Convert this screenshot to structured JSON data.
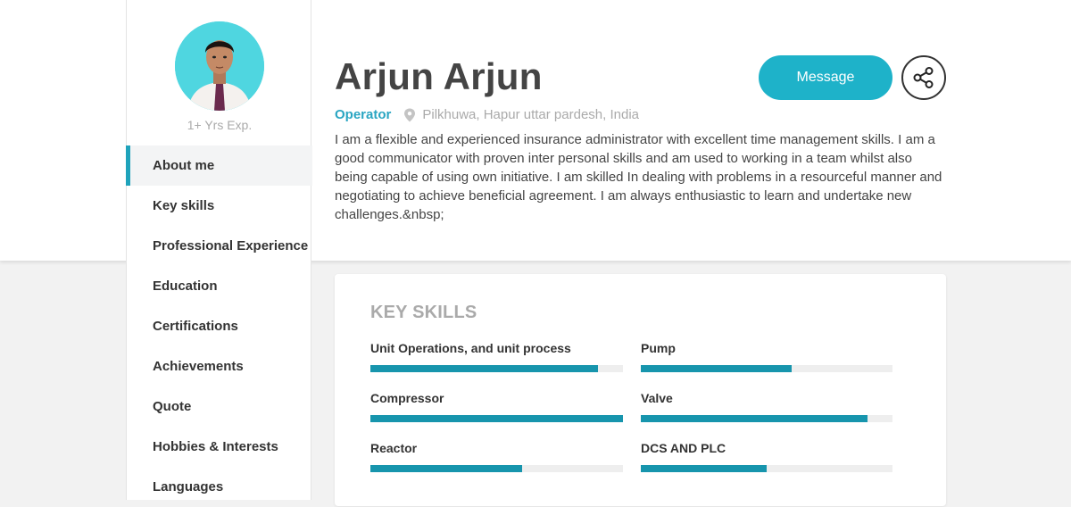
{
  "profile": {
    "name": "Arjun Arjun",
    "role": "Operator",
    "location": "Pilkhuwa, Hapur uttar pardesh, India",
    "experience": "1+ Yrs Exp.",
    "bio": "I am a flexible and experienced insurance administrator with excellent time management skills. I am a good communicator with proven inter personal skills and am used to working in a team whilst also being capable of using own initiative. I am skilled In dealing with problems in a resourceful manner and negotiating to achieve beneficial agreement. I am always enthusiastic to learn and undertake new challenges.&nbsp;"
  },
  "actions": {
    "message_label": "Message",
    "share_icon": "share-icon"
  },
  "sidebar": {
    "items": [
      {
        "label": "About me",
        "active": true
      },
      {
        "label": "Key skills",
        "active": false
      },
      {
        "label": "Professional Experience",
        "active": false
      },
      {
        "label": "Education",
        "active": false
      },
      {
        "label": "Certifications",
        "active": false
      },
      {
        "label": "Achievements",
        "active": false
      },
      {
        "label": "Quote",
        "active": false
      },
      {
        "label": "Hobbies & Interests",
        "active": false
      },
      {
        "label": "Languages",
        "active": false
      }
    ]
  },
  "key_skills": {
    "title": "KEY SKILLS",
    "skills": [
      {
        "name": "Unit Operations, and unit process",
        "level": 0.9
      },
      {
        "name": "Pump",
        "level": 0.6
      },
      {
        "name": "Compressor",
        "level": 1.0
      },
      {
        "name": "Valve",
        "level": 0.9
      },
      {
        "name": "Reactor",
        "level": 0.6
      },
      {
        "name": "DCS AND PLC",
        "level": 0.5
      }
    ]
  },
  "colors": {
    "accent": "#1eb2c9",
    "role_text": "#29a5c2",
    "skill_bar": "#1795ad",
    "avatar_bg": "#4fd6e0"
  }
}
